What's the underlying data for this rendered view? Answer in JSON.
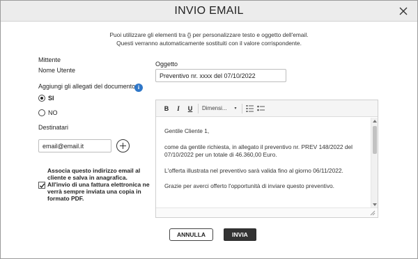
{
  "dialog": {
    "title": "INVIO EMAIL"
  },
  "intro": {
    "line1": "Puoi utilizzare gli elementi tra {} per personalizzare testo e oggetto dell'email.",
    "line2": "Questi verranno automaticamente sostituiti con il valore corrispondente."
  },
  "sender": {
    "label": "Mittente",
    "user_name": "Nome Utente"
  },
  "attachments": {
    "label": "Aggiungi gli allegati del documento",
    "info_icon": "info-icon",
    "options": [
      {
        "label": "SI",
        "selected": true
      },
      {
        "label": "NO",
        "selected": false
      }
    ]
  },
  "recipients": {
    "label": "Destinatari",
    "email_value": "email@email.it",
    "add_icon": "plus-circle-icon"
  },
  "associate": {
    "checked": true,
    "text": "Associa questo indirizzo email al cliente e salva in anagrafica. All'invio di una fattura elettronica ne verrà sempre inviata una copia in formato PDF."
  },
  "subject": {
    "label": "Oggetto",
    "value": "Preventivo nr. xxxx del 07/10/2022"
  },
  "editor": {
    "toolbar": {
      "bold": "B",
      "italic": "I",
      "underline": "U",
      "font_size": "Dimensi...",
      "font_arrow": "▾"
    },
    "paragraphs": [
      "Gentile Cliente 1,",
      "come da gentile richiesta, in allegato il preventivo nr. PREV 148/2022 del 07/10/2022 per un totale di 46.360,00 Euro.",
      "L'offerta illustrata nel preventivo sarà valida fino al giorno 06/11/2022.",
      "Grazie per averci offerto l'opportunità di inviare questo preventivo."
    ]
  },
  "actions": {
    "cancel": "ANNULLA",
    "send": "INVIA"
  },
  "colors": {
    "info_blue": "#2f77c8",
    "send_bg": "#333333"
  }
}
